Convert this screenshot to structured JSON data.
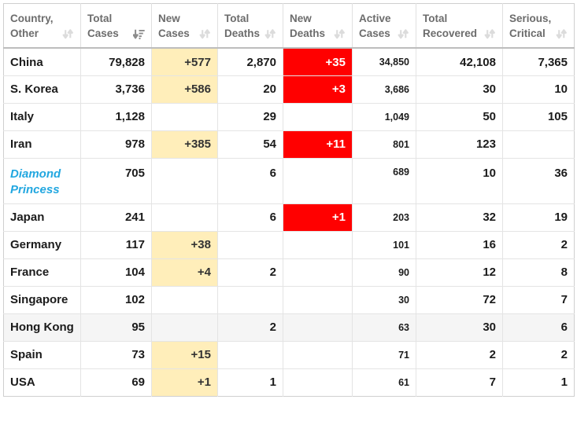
{
  "table": {
    "columns": [
      {
        "label_line1": "Country,",
        "label_line2": "Other",
        "sort_icon": "sort-both-icon",
        "sort_state": "none",
        "align": "left"
      },
      {
        "label_line1": "Total",
        "label_line2": "Cases",
        "sort_icon": "sort-amount-desc-icon",
        "sort_state": "descending",
        "align": "right"
      },
      {
        "label_line1": "New",
        "label_line2": "Cases",
        "sort_icon": "sort-both-icon",
        "sort_state": "none",
        "align": "right"
      },
      {
        "label_line1": "Total",
        "label_line2": "Deaths",
        "sort_icon": "sort-both-icon",
        "sort_state": "none",
        "align": "right"
      },
      {
        "label_line1": "New",
        "label_line2": "Deaths",
        "sort_icon": "sort-both-icon",
        "sort_state": "none",
        "align": "right"
      },
      {
        "label_line1": "Active",
        "label_line2": "Cases",
        "sort_icon": "sort-both-icon",
        "sort_state": "none",
        "align": "right"
      },
      {
        "label_line1": "Total",
        "label_line2": "Recovered",
        "sort_icon": "sort-both-icon",
        "sort_state": "none",
        "align": "right"
      },
      {
        "label_line1": "Serious,",
        "label_line2": "Critical",
        "sort_icon": "sort-both-icon",
        "sort_state": "none",
        "align": "right"
      }
    ],
    "rows": [
      {
        "country": "China",
        "country_style": "plain",
        "highlighted": false,
        "tall": false,
        "total_cases": "79,828",
        "new_cases": "+577",
        "total_deaths": "2,870",
        "new_deaths": "+35",
        "active_cases": "34,850",
        "total_recovered": "42,108",
        "serious_critical": "7,365"
      },
      {
        "country": "S. Korea",
        "country_style": "plain",
        "highlighted": false,
        "tall": false,
        "total_cases": "3,736",
        "new_cases": "+586",
        "total_deaths": "20",
        "new_deaths": "+3",
        "active_cases": "3,686",
        "total_recovered": "30",
        "serious_critical": "10"
      },
      {
        "country": "Italy",
        "country_style": "plain",
        "highlighted": false,
        "tall": false,
        "total_cases": "1,128",
        "new_cases": "",
        "total_deaths": "29",
        "new_deaths": "",
        "active_cases": "1,049",
        "total_recovered": "50",
        "serious_critical": "105"
      },
      {
        "country": "Iran",
        "country_style": "plain",
        "highlighted": false,
        "tall": false,
        "total_cases": "978",
        "new_cases": "+385",
        "total_deaths": "54",
        "new_deaths": "+11",
        "active_cases": "801",
        "total_recovered": "123",
        "serious_critical": ""
      },
      {
        "country": "Diamond Princess",
        "country_style": "link",
        "highlighted": false,
        "tall": true,
        "total_cases": "705",
        "new_cases": "",
        "total_deaths": "6",
        "new_deaths": "",
        "active_cases": "689",
        "total_recovered": "10",
        "serious_critical": "36"
      },
      {
        "country": "Japan",
        "country_style": "plain",
        "highlighted": false,
        "tall": false,
        "total_cases": "241",
        "new_cases": "",
        "total_deaths": "6",
        "new_deaths": "+1",
        "active_cases": "203",
        "total_recovered": "32",
        "serious_critical": "19"
      },
      {
        "country": "Germany",
        "country_style": "plain",
        "highlighted": false,
        "tall": false,
        "total_cases": "117",
        "new_cases": "+38",
        "total_deaths": "",
        "new_deaths": "",
        "active_cases": "101",
        "total_recovered": "16",
        "serious_critical": "2"
      },
      {
        "country": "France",
        "country_style": "plain",
        "highlighted": false,
        "tall": false,
        "total_cases": "104",
        "new_cases": "+4",
        "total_deaths": "2",
        "new_deaths": "",
        "active_cases": "90",
        "total_recovered": "12",
        "serious_critical": "8"
      },
      {
        "country": "Singapore",
        "country_style": "plain",
        "highlighted": false,
        "tall": false,
        "total_cases": "102",
        "new_cases": "",
        "total_deaths": "",
        "new_deaths": "",
        "active_cases": "30",
        "total_recovered": "72",
        "serious_critical": "7"
      },
      {
        "country": "Hong Kong",
        "country_style": "plain",
        "highlighted": true,
        "tall": false,
        "total_cases": "95",
        "new_cases": "",
        "total_deaths": "2",
        "new_deaths": "",
        "active_cases": "63",
        "total_recovered": "30",
        "serious_critical": "6"
      },
      {
        "country": "Spain",
        "country_style": "plain",
        "highlighted": false,
        "tall": false,
        "total_cases": "73",
        "new_cases": "+15",
        "total_deaths": "",
        "new_deaths": "",
        "active_cases": "71",
        "total_recovered": "2",
        "serious_critical": "2"
      },
      {
        "country": "USA",
        "country_style": "plain",
        "highlighted": false,
        "tall": false,
        "total_cases": "69",
        "new_cases": "+1",
        "total_deaths": "1",
        "new_deaths": "",
        "active_cases": "61",
        "total_recovered": "7",
        "serious_critical": "1"
      }
    ]
  },
  "colors": {
    "new_cases_highlight": "#ffeeba",
    "new_deaths_highlight": "#ff0000",
    "row_highlight": "#f5f5f5",
    "link": "#22a7e0",
    "header_text": "#6c6c6c",
    "body_text": "#1b1b1b",
    "border": "#e4e4e4"
  }
}
